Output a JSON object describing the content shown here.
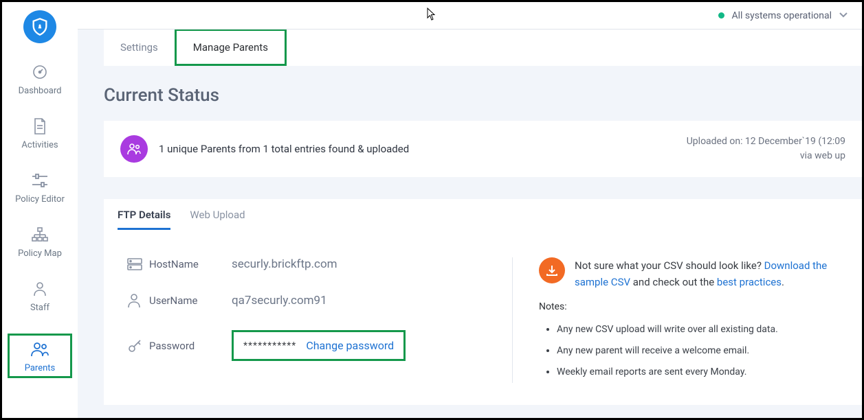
{
  "topbar": {
    "status_text": "All systems operational"
  },
  "sidebar": {
    "items": [
      {
        "label": "Dashboard"
      },
      {
        "label": "Activities"
      },
      {
        "label": "Policy Editor"
      },
      {
        "label": "Policy Map"
      },
      {
        "label": "Staff"
      },
      {
        "label": "Parents"
      }
    ]
  },
  "tabs_top": {
    "settings": "Settings",
    "manage": "Manage Parents"
  },
  "page_title": "Current Status",
  "status": {
    "summary": "1 unique Parents from 1 total entries found & uploaded",
    "meta_line1": "Uploaded on: 12 December`19 (12:09",
    "meta_line2": "via web up"
  },
  "tabs_inner": {
    "ftp": "FTP Details",
    "web": "Web Upload"
  },
  "ftp": {
    "host_label": "HostName",
    "host_value": "securly.brickftp.com",
    "user_label": "UserName",
    "user_value": "qa7securly.com91",
    "pass_label": "Password",
    "pass_masked": "***********",
    "change_password": "Change password"
  },
  "help": {
    "intro": "Not sure what your CSV should look like? ",
    "link1": "Download the sample CSV",
    "mid": " and check out the  ",
    "link2": "best practices",
    "dot": ".",
    "notes_title": "Notes:",
    "notes": [
      "Any new CSV upload will write over all existing data.",
      "Any new parent will receive a welcome email.",
      "Weekly email reports are sent every Monday."
    ]
  }
}
